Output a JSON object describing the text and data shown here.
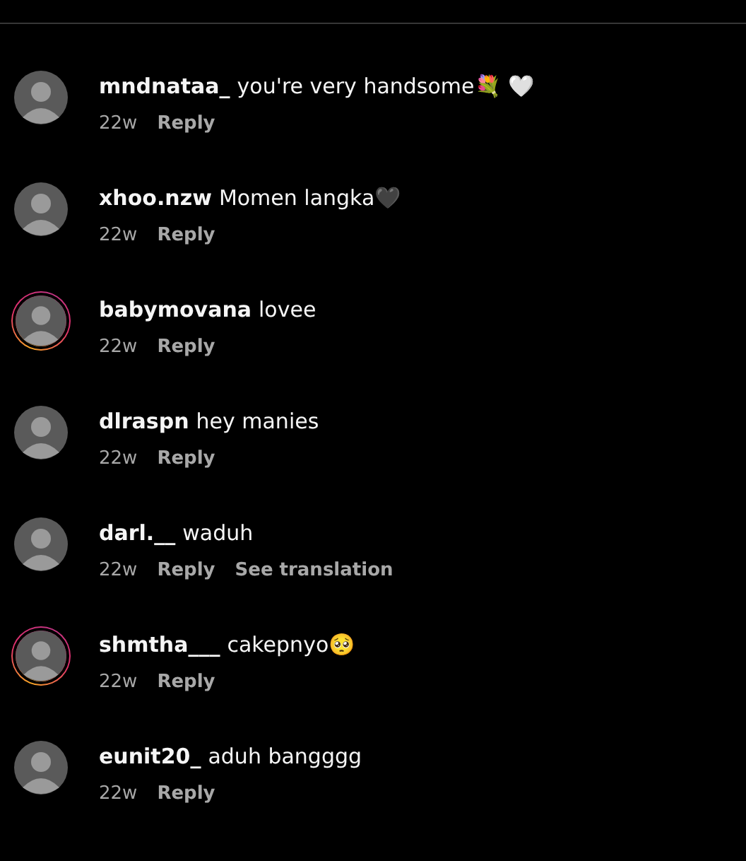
{
  "comments": [
    {
      "username": "mndnataa_",
      "text": "you're very handsome💐 🤍",
      "time": "22w",
      "reply": "Reply",
      "story_ring": false
    },
    {
      "username": "xhoo.nzw",
      "text": "Momen langka🖤",
      "time": "22w",
      "reply": "Reply",
      "story_ring": false
    },
    {
      "username": "babymovana",
      "text": "lovee",
      "time": "22w",
      "reply": "Reply",
      "story_ring": true
    },
    {
      "username": "dlraspn",
      "text": "hey manies",
      "time": "22w",
      "reply": "Reply",
      "story_ring": false
    },
    {
      "username": "darl.__",
      "text": "waduh",
      "time": "22w",
      "reply": "Reply",
      "translation": "See translation",
      "story_ring": false
    },
    {
      "username": "shmtha___",
      "text": "cakepnyo🥺",
      "time": "22w",
      "reply": "Reply",
      "story_ring": true
    },
    {
      "username": "eunit20_",
      "text": "aduh bangggg",
      "time": "22w",
      "reply": "Reply",
      "story_ring": false
    }
  ]
}
